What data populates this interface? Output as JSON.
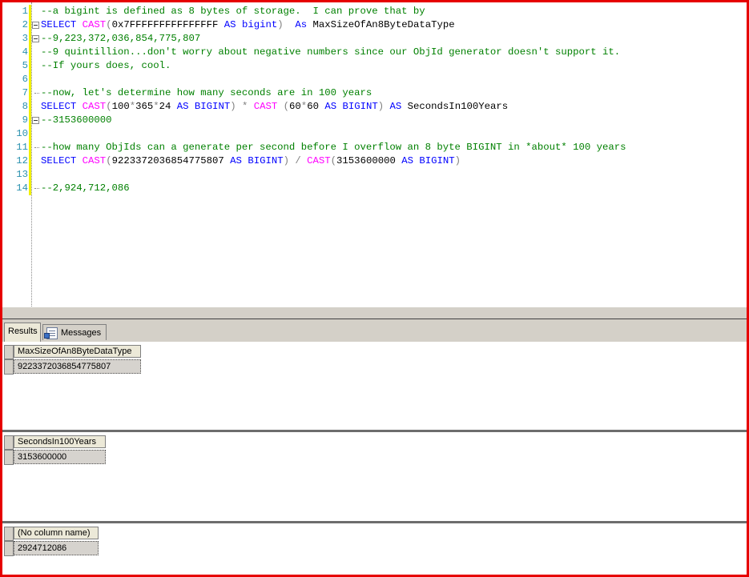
{
  "editor": {
    "lines": [
      {
        "num": "1",
        "segments": [
          {
            "t": "--a bigint is defined as 8 bytes of storage.  I can prove that by",
            "c": "cm"
          }
        ]
      },
      {
        "num": "2",
        "fold": true,
        "segments": [
          {
            "t": "SELECT ",
            "c": "kw"
          },
          {
            "t": "CAST",
            "c": "fn"
          },
          {
            "t": "(",
            "c": "op"
          },
          {
            "t": "0x7FFFFFFFFFFFFFFF ",
            "c": ""
          },
          {
            "t": "AS ",
            "c": "kw"
          },
          {
            "t": "bigint",
            "c": "kw"
          },
          {
            "t": ")",
            "c": "op"
          },
          {
            "t": "  As ",
            "c": "kw"
          },
          {
            "t": "MaxSizeOfAn8ByteDataType",
            "c": ""
          }
        ]
      },
      {
        "num": "3",
        "fold": true,
        "segments": [
          {
            "t": "--9,223,372,036,854,775,807",
            "c": "cm"
          }
        ]
      },
      {
        "num": "4",
        "segments": [
          {
            "t": "--9 quintillion...don't worry about negative numbers since our ObjId generator doesn't support it.",
            "c": "cm"
          }
        ]
      },
      {
        "num": "5",
        "segments": [
          {
            "t": "--If yours does, cool.",
            "c": "cm"
          }
        ]
      },
      {
        "num": "6",
        "segments": []
      },
      {
        "num": "7",
        "foldtick": true,
        "segments": [
          {
            "t": "--now, let's determine how many seconds are in 100 years",
            "c": "cm"
          }
        ]
      },
      {
        "num": "8",
        "segments": [
          {
            "t": "SELECT ",
            "c": "kw"
          },
          {
            "t": "CAST",
            "c": "fn"
          },
          {
            "t": "(",
            "c": "op"
          },
          {
            "t": "100",
            "c": ""
          },
          {
            "t": "*",
            "c": "op"
          },
          {
            "t": "365",
            "c": ""
          },
          {
            "t": "*",
            "c": "op"
          },
          {
            "t": "24 ",
            "c": ""
          },
          {
            "t": "AS ",
            "c": "kw"
          },
          {
            "t": "BIGINT",
            "c": "kw"
          },
          {
            "t": ") * ",
            "c": "op"
          },
          {
            "t": "CAST ",
            "c": "fn"
          },
          {
            "t": "(",
            "c": "op"
          },
          {
            "t": "60",
            "c": ""
          },
          {
            "t": "*",
            "c": "op"
          },
          {
            "t": "60 ",
            "c": ""
          },
          {
            "t": "AS ",
            "c": "kw"
          },
          {
            "t": "BIGINT",
            "c": "kw"
          },
          {
            "t": ") ",
            "c": "op"
          },
          {
            "t": "AS ",
            "c": "kw"
          },
          {
            "t": "SecondsIn100Years",
            "c": ""
          }
        ]
      },
      {
        "num": "9",
        "fold": true,
        "segments": [
          {
            "t": "--3153600000",
            "c": "cm"
          }
        ]
      },
      {
        "num": "10",
        "segments": []
      },
      {
        "num": "11",
        "foldtick": true,
        "segments": [
          {
            "t": "--how many ObjIds can a generate per second before I overflow an 8 byte BIGINT in *about* 100 years",
            "c": "cm"
          }
        ]
      },
      {
        "num": "12",
        "segments": [
          {
            "t": "SELECT ",
            "c": "kw"
          },
          {
            "t": "CAST",
            "c": "fn"
          },
          {
            "t": "(",
            "c": "op"
          },
          {
            "t": "9223372036854775807 ",
            "c": ""
          },
          {
            "t": "AS ",
            "c": "kw"
          },
          {
            "t": "BIGINT",
            "c": "kw"
          },
          {
            "t": ") / ",
            "c": "op"
          },
          {
            "t": "CAST",
            "c": "fn"
          },
          {
            "t": "(",
            "c": "op"
          },
          {
            "t": "3153600000 ",
            "c": ""
          },
          {
            "t": "AS ",
            "c": "kw"
          },
          {
            "t": "BIGINT",
            "c": "kw"
          },
          {
            "t": ")",
            "c": "op"
          }
        ]
      },
      {
        "num": "13",
        "segments": []
      },
      {
        "num": "14",
        "foldtick": true,
        "segments": [
          {
            "t": "--2,924,712,086",
            "c": "cm"
          }
        ]
      }
    ]
  },
  "tabs": {
    "results_label": "Results",
    "messages_label": "Messages",
    "messages_icon": "messages-icon"
  },
  "results": [
    {
      "column": "MaxSizeOfAn8ByteDataType",
      "value": "9223372036854775807"
    },
    {
      "column": "SecondsIn100Years",
      "value": "3153600000"
    },
    {
      "column": "(No column name)",
      "value": "2924712086"
    }
  ],
  "colors": {
    "frame": "#e60000",
    "keyword": "#0000ff",
    "function": "#ff00ff",
    "comment": "#008000",
    "line_number": "#2b91af"
  }
}
